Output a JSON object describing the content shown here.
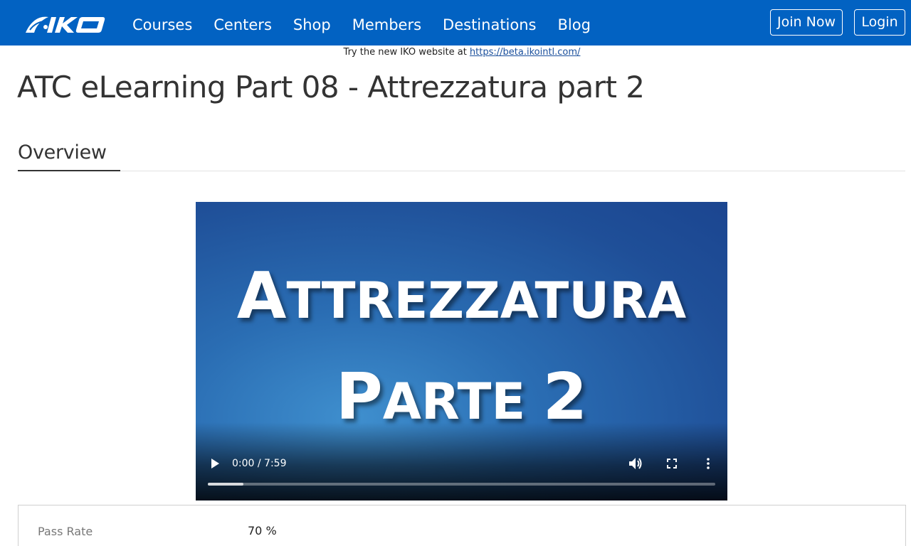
{
  "header": {
    "logo_text": "IKO",
    "nav_items": [
      {
        "label": "Courses"
      },
      {
        "label": "Centers"
      },
      {
        "label": "Shop"
      },
      {
        "label": "Members"
      },
      {
        "label": "Destinations"
      },
      {
        "label": "Blog"
      }
    ],
    "join_label": "Join Now",
    "login_label": "Login"
  },
  "banner": {
    "text": "Try the new IKO website at ",
    "link_text": "https://beta.ikointl.com/"
  },
  "page": {
    "title": "ATC eLearning Part 08 - Attrezzatura part 2",
    "tab_overview": "Overview"
  },
  "video": {
    "title_line1_initial": "A",
    "title_line1_rest": "TTREZZATURA",
    "title_line2_initial": "P",
    "title_line2_rest": "ARTE ",
    "title_line2_number": "2",
    "time": "0:00 / 7:59",
    "buffered_fraction": 0.07
  },
  "info": {
    "pass_rate_label": "Pass Rate",
    "pass_rate_value": "70 %"
  },
  "colors": {
    "nav_bg": "#0262c2",
    "banner_link": "#1a4f9c"
  },
  "icons": {
    "logo": "iko-logo",
    "play": "play-icon",
    "volume": "volume-icon",
    "fullscreen": "fullscreen-icon",
    "more": "more-vertical-icon"
  }
}
